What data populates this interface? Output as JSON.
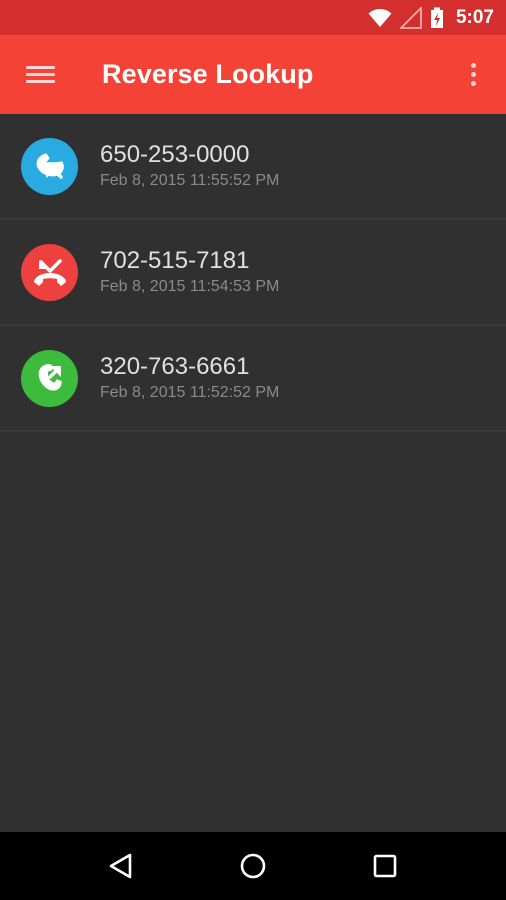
{
  "status_bar": {
    "time": "5:07",
    "icons": [
      "wifi-icon",
      "cell-signal-icon",
      "battery-charging-icon"
    ]
  },
  "app_bar": {
    "title": "Reverse Lookup",
    "menu_icon": "menu-icon",
    "overflow_icon": "more-vert-icon"
  },
  "calls": [
    {
      "number": "650-253-0000",
      "timestamp": "Feb 8, 2015 11:55:52 PM",
      "type": "incoming",
      "icon": "call-incoming-icon",
      "color": "#29abe2"
    },
    {
      "number": "702-515-7181",
      "timestamp": "Feb 8, 2015 11:54:53 PM",
      "type": "missed",
      "icon": "call-missed-icon",
      "color": "#ef4040"
    },
    {
      "number": "320-763-6661",
      "timestamp": "Feb 8, 2015 11:52:52 PM",
      "type": "outgoing",
      "icon": "call-outgoing-icon",
      "color": "#3dbb3d"
    }
  ],
  "nav_bar": {
    "buttons": [
      "back-icon",
      "home-icon",
      "recents-icon"
    ]
  },
  "colors": {
    "status_bar": "#d32f2f",
    "app_bar": "#f44336",
    "background": "#303030"
  }
}
